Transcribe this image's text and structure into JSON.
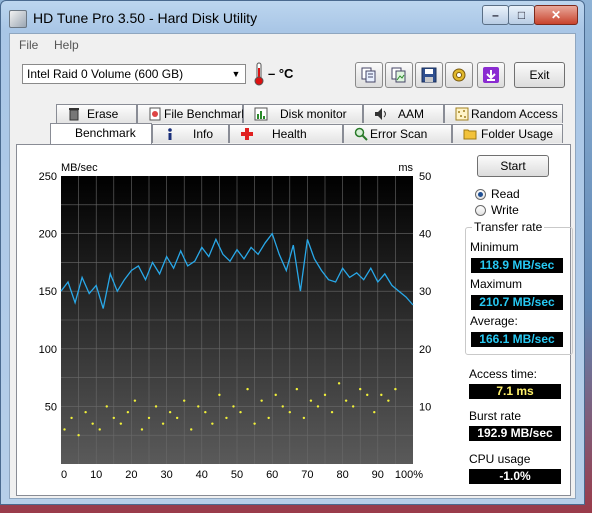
{
  "window": {
    "title": "HD Tune Pro 3.50 - Hard Disk Utility",
    "caption_min": "–",
    "caption_max": "□",
    "caption_close": "✕"
  },
  "menu": {
    "file": "File",
    "help": "Help"
  },
  "toolbar": {
    "drive_selected": "Intel   Raid 0 Volume (600 GB)",
    "temperature": "– °C",
    "exit_label": "Exit",
    "icons": [
      "copy-text-icon",
      "copy-image-icon",
      "save-icon",
      "options-icon",
      "download-icon"
    ]
  },
  "tabs": {
    "top": [
      "Erase",
      "File Benchmark",
      "Disk monitor",
      "AAM",
      "Random Access"
    ],
    "bottom": [
      "Benchmark",
      "Info",
      "Health",
      "Error Scan",
      "Folder Usage"
    ],
    "active": "Benchmark"
  },
  "controls": {
    "start_label": "Start",
    "read_label": "Read",
    "write_label": "Write",
    "selected_mode": "Read"
  },
  "results": {
    "group_title": "Transfer rate",
    "minimum_label": "Minimum",
    "minimum_value": "118.9 MB/sec",
    "maximum_label": "Maximum",
    "maximum_value": "210.7 MB/sec",
    "average_label": "Average:",
    "average_value": "166.1 MB/sec",
    "access_label": "Access time:",
    "access_value": "7.1 ms",
    "burst_label": "Burst rate",
    "burst_value": "192.9 MB/sec",
    "cpu_label": "CPU usage",
    "cpu_value": "-1.0%"
  },
  "colors": {
    "transfer_line": "#29a8e8",
    "access_points": "#f1f13a",
    "chart_bg_top": "#000000",
    "chart_bg_bottom": "#5a5a5a",
    "cyan_text": "#27c9f3",
    "yellow_text": "#fff16a"
  },
  "chart_data": {
    "type": "line",
    "left_unit": "MB/sec",
    "right_unit": "ms",
    "y_ticks_left": [
      "250",
      "200",
      "150",
      "100",
      "50"
    ],
    "y_ticks_right": [
      "50",
      "40",
      "30",
      "20",
      "10"
    ],
    "x_ticks": [
      "0",
      "10",
      "20",
      "30",
      "40",
      "50",
      "60",
      "70",
      "80",
      "90",
      "100%"
    ],
    "ylim_left": [
      0,
      250
    ],
    "ylim_right": [
      0,
      50
    ],
    "xlim": [
      0,
      100
    ],
    "grid": true,
    "series": [
      {
        "axis": "left",
        "x": [
          0,
          2,
          4,
          6,
          8,
          10,
          12,
          14,
          16,
          18,
          20,
          22,
          24,
          26,
          28,
          30,
          32,
          34,
          36,
          38,
          40,
          42,
          44,
          46,
          48,
          50,
          52,
          54,
          56,
          58,
          60,
          62,
          64,
          66,
          68,
          70,
          72,
          74,
          76,
          78,
          80,
          82,
          84,
          86,
          88,
          90,
          92,
          94,
          96,
          98,
          100
        ],
        "values": [
          150,
          158,
          140,
          162,
          148,
          155,
          135,
          165,
          150,
          160,
          168,
          172,
          160,
          175,
          165,
          180,
          170,
          185,
          172,
          176,
          188,
          180,
          195,
          182,
          176,
          186,
          178,
          188,
          182,
          192,
          200,
          182,
          168,
          190,
          150,
          195,
          178,
          168,
          160,
          158,
          170,
          162,
          166,
          160,
          170,
          158,
          165,
          155,
          150,
          145,
          138
        ]
      },
      {
        "axis": "right",
        "type": "scatter",
        "x": [
          1,
          3,
          5,
          7,
          9,
          11,
          13,
          15,
          17,
          19,
          21,
          23,
          25,
          27,
          29,
          31,
          33,
          35,
          37,
          39,
          41,
          43,
          45,
          47,
          49,
          51,
          53,
          55,
          57,
          59,
          61,
          63,
          65,
          67,
          69,
          71,
          73,
          75,
          77,
          79,
          81,
          83,
          85,
          87,
          89,
          91,
          93,
          95
        ],
        "values": [
          6,
          8,
          5,
          9,
          7,
          6,
          10,
          8,
          7,
          9,
          11,
          6,
          8,
          10,
          7,
          9,
          8,
          11,
          6,
          10,
          9,
          7,
          12,
          8,
          10,
          9,
          13,
          7,
          11,
          8,
          12,
          10,
          9,
          13,
          8,
          11,
          10,
          12,
          9,
          14,
          11,
          10,
          13,
          12,
          9,
          12,
          11,
          13
        ]
      }
    ]
  }
}
